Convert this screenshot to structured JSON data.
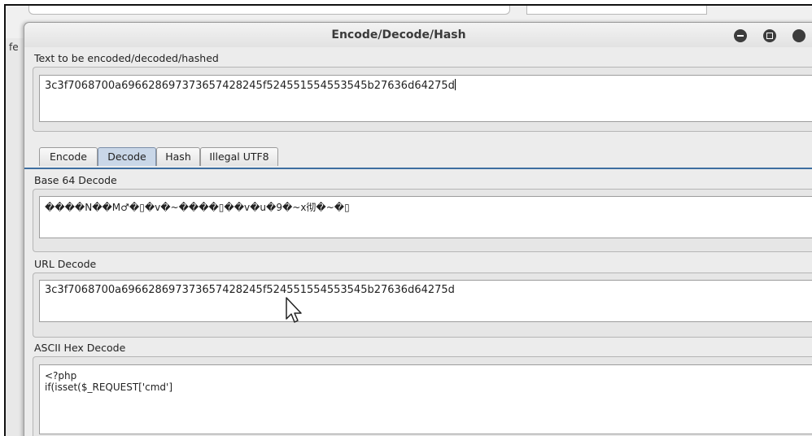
{
  "background_app": {
    "left_fragment": "fe"
  },
  "window": {
    "title": "Encode/Decode/Hash"
  },
  "input": {
    "label": "Text to be encoded/decoded/hashed",
    "value": "3c3f7068700a696628697373657428245f524551554553545b27636d64275d"
  },
  "tabs": [
    {
      "label": "Encode",
      "active": false
    },
    {
      "label": "Decode",
      "active": true
    },
    {
      "label": "Hash",
      "active": false
    },
    {
      "label": "Illegal UTF8",
      "active": false
    }
  ],
  "panels": {
    "base64": {
      "label": "Base 64 Decode",
      "value": "����N��M♂�▯�v�~����▯��v�u�9�~x彻�~�▯"
    },
    "url": {
      "label": "URL Decode",
      "value": "3c3f7068700a696628697373657428245f524551554553545b27636d64275d"
    },
    "ascii_hex": {
      "label": "ASCII Hex Decode",
      "line1": "<?php",
      "line2": "if(isset($_REQUEST['cmd']"
    }
  },
  "colors": {
    "active_tab": "#c9d7e8",
    "tab_line": "#3e6ea0",
    "window_button": "#3c3c3c"
  }
}
